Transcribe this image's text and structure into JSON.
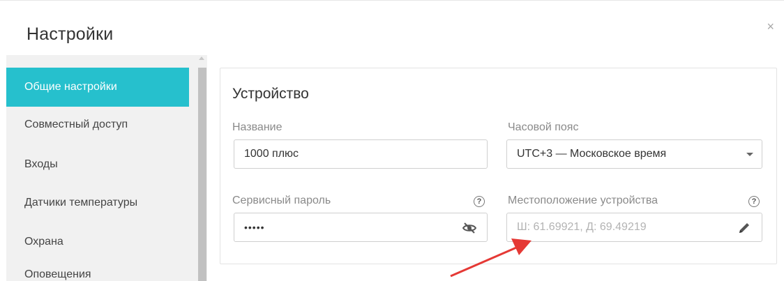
{
  "dialog": {
    "title": "Настройки",
    "close_glyph": "×"
  },
  "sidebar": {
    "items": [
      {
        "label": "Общие настройки",
        "active": true
      },
      {
        "label": "Совместный доступ",
        "active": false
      },
      {
        "label": "Входы",
        "active": false
      },
      {
        "label": "Датчики температуры",
        "active": false
      },
      {
        "label": "Охрана",
        "active": false
      },
      {
        "label": "Оповещения",
        "active": false
      }
    ]
  },
  "device": {
    "title": "Устройство",
    "name": {
      "label": "Название",
      "value": "1000 плюс"
    },
    "timezone": {
      "label": "Часовой пояс",
      "value": "UTC+3 — Московское время"
    },
    "service_password": {
      "label": "Сервисный пароль",
      "value": "•••••",
      "help_glyph": "?",
      "toggle_icon": "eye-off-icon"
    },
    "location": {
      "label": "Местоположение устройства",
      "placeholder": "Ш: 61.69921, Д: 69.49219",
      "help_glyph": "?",
      "edit_icon": "pencil-icon"
    }
  },
  "colors": {
    "accent": "#26c0cd",
    "annotation_arrow": "#e53935"
  }
}
